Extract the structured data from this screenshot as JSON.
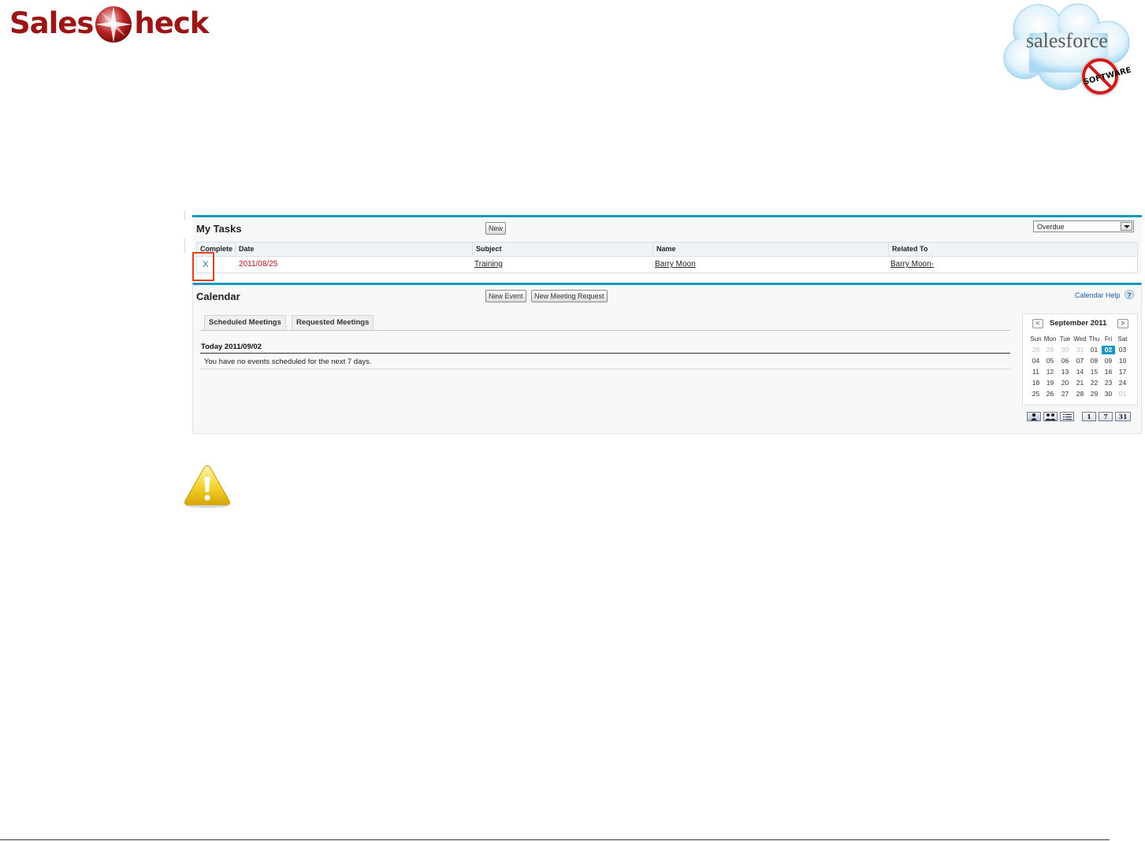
{
  "brand": {
    "logo_text_left": "Sales",
    "logo_text_right": "heck",
    "partner_logo_text": "salesforce",
    "partner_logo_stamp": "SOFTWARE"
  },
  "tasks": {
    "title": "My Tasks",
    "new_button": "New",
    "view_selected": "Overdue",
    "columns": [
      "Complete",
      "Date",
      "Subject",
      "Name",
      "Related To"
    ],
    "rows": [
      {
        "complete": "X",
        "date": "2011/08/25",
        "subject": "Training",
        "name": "Barry Moon",
        "related_to": "Barry Moon-"
      }
    ]
  },
  "calendar": {
    "title": "Calendar",
    "new_event_button": "New Event",
    "new_meeting_request_button": "New Meeting Request",
    "help_link": "Calendar Help",
    "help_icon": "?",
    "tabs": [
      "Scheduled Meetings",
      "Requested Meetings"
    ],
    "today_label": "Today 2011/09/02",
    "no_events_text": "You have no events scheduled for the next 7 days.",
    "mini_calendar": {
      "month_title": "September 2011",
      "prev": "<",
      "next": ">",
      "weekdays": [
        "Sun",
        "Mon",
        "Tue",
        "Wed",
        "Thu",
        "Fri",
        "Sat"
      ],
      "weeks": [
        [
          "28",
          "29",
          "30",
          "31",
          "01",
          "02",
          "03"
        ],
        [
          "04",
          "05",
          "06",
          "07",
          "08",
          "09",
          "10"
        ],
        [
          "11",
          "12",
          "13",
          "14",
          "15",
          "16",
          "17"
        ],
        [
          "18",
          "19",
          "20",
          "21",
          "22",
          "23",
          "24"
        ],
        [
          "25",
          "26",
          "27",
          "28",
          "29",
          "30",
          "01"
        ]
      ],
      "today": "02"
    },
    "view_buttons": {
      "single_user": "person-icon",
      "multi_user": "people-icon",
      "list": "list-icon",
      "day": "1",
      "week": "7",
      "month": "31"
    }
  },
  "colors": {
    "brand_red": "#9b1515",
    "panel_accent": "#1797c0",
    "highlight": "#e0401a"
  }
}
